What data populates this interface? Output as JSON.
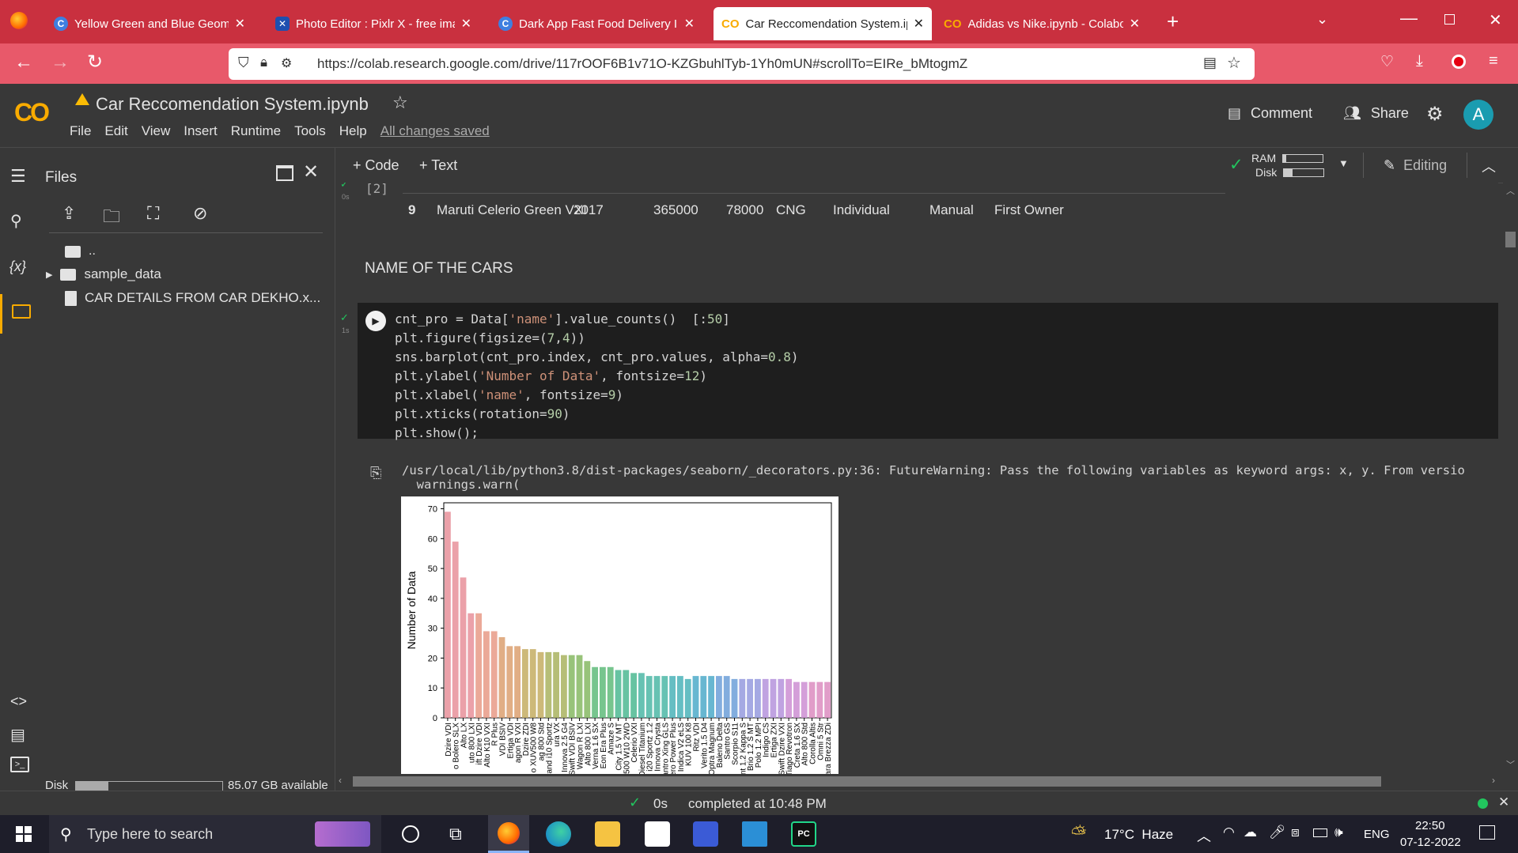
{
  "browser": {
    "tabs": [
      {
        "title": "Yellow Green and Blue Geometr",
        "active": false,
        "icon": "canva-icon"
      },
      {
        "title": "Photo Editor : Pixlr X - free imac",
        "active": false,
        "icon": "pixlr-icon"
      },
      {
        "title": "Dark App Fast Food Delivery Ins",
        "active": false,
        "icon": "canva-icon"
      },
      {
        "title": "Car Reccomendation System.ipy",
        "active": true,
        "icon": "colab-icon"
      },
      {
        "title": "Adidas vs Nike.ipynb - Colabora",
        "active": false,
        "icon": "colab-icon"
      }
    ],
    "url": "https://colab.research.google.com/drive/117rOOF6B1v71O-KZGbuhlTyb-1Yh0mUN#scrollTo=EIRe_bMtogmZ"
  },
  "colab": {
    "notebook_title": "Car Reccomendation System.ipynb",
    "menu": [
      "File",
      "Edit",
      "View",
      "Insert",
      "Runtime",
      "Tools",
      "Help"
    ],
    "saved_status": "All changes saved",
    "comment_label": "Comment",
    "share_label": "Share",
    "avatar_letter": "A",
    "toolbar": {
      "code_label": "+ Code",
      "text_label": "+ Text",
      "ram_label": "RAM",
      "disk_label": "Disk",
      "editing_label": "Editing"
    }
  },
  "files_panel": {
    "title": "Files",
    "items": [
      {
        "name": "..",
        "type": "up"
      },
      {
        "name": "sample_data",
        "type": "folder"
      },
      {
        "name": "CAR DETAILS FROM CAR DEKHO.x...",
        "type": "file"
      }
    ],
    "disk_label": "Disk",
    "disk_available": "85.07 GB available",
    "disk_usage_fraction": 0.22
  },
  "table_row": {
    "index": "9",
    "cells": [
      "Maruti Celerio Green VXI",
      "2017",
      "365000",
      "78000",
      "CNG",
      "Individual",
      "Manual",
      "First Owner"
    ]
  },
  "cells": {
    "prev_exec": "[2]",
    "prev_time": "0s",
    "heading": "NAME OF THE CARS",
    "exec_time": "1s",
    "output_warning": "/usr/local/lib/python3.8/dist-packages/seaborn/_decorators.py:36: FutureWarning: Pass the following variables as keyword args: x, y. From versio",
    "output_warning2": "  warnings.warn("
  },
  "chart_data": {
    "type": "bar",
    "ylabel": "Number of Data",
    "ylim": [
      0,
      72
    ],
    "yticks": [
      0,
      10,
      20,
      30,
      40,
      50,
      60,
      70
    ],
    "values": [
      69,
      59,
      47,
      35,
      35,
      29,
      29,
      27,
      24,
      24,
      23,
      23,
      22,
      22,
      22,
      21,
      21,
      21,
      19,
      17,
      17,
      17,
      16,
      16,
      15,
      15,
      14,
      14,
      14,
      14,
      14,
      13,
      14,
      14,
      14,
      14,
      14,
      13,
      13,
      13,
      13,
      13,
      13,
      13,
      13,
      12,
      12,
      12,
      12,
      12
    ],
    "categories": [
      "Dzire VDI",
      "o Bolero SLX",
      "Alto LX",
      "uto 800 LXI",
      "ift Dzire VDI",
      "Alto K10 VXI",
      "R Plus",
      "VDI BSIV",
      "Ertiga VDI",
      "agon R VXI",
      "Dzire ZDI",
      "o XUV500 W8",
      "ag 800 Std",
      "Grand i10 Sportz",
      "ura VX",
      "Innova 2.5 G4",
      "Swift VDI BSIV",
      "Wagon R LXI",
      "Alto 800 LXI",
      "Verna 1.6 SX",
      "Eon Era Plus",
      "Amaze S",
      "City 1.5 V MT",
      "XUV500 W10 2WD",
      "Celerio VXI",
      "EcoSport 1.5 Diesel Titanium",
      "i20 Sportz 1.2",
      "Innova Crysta",
      "Santro Xing GLS",
      "Bolero Power Plus",
      "Indica V2 eLS",
      "KUV 100 K8",
      "Ritz VDI",
      "Verito 1.5 D4",
      "Optra Magnum",
      "Baleno Delta",
      "Santro GS",
      "Scorpio S11",
      "Xcent 1.2 Kappa S",
      "Brio 1.2 S MT",
      "Polo 1.2 MPI",
      "Indigo CS",
      "Ertiga ZXI",
      "Swift Dzire VXI",
      "Tiago Revotron",
      "Creta 1.6 SX",
      "Alto 800 Std",
      "Corolla Altis",
      "Omni 5 Str",
      "Vitara Brezza ZDi"
    ]
  },
  "status": {
    "time": "0s",
    "completed": "completed at 10:48 PM"
  },
  "taskbar": {
    "search_placeholder": "Type here to search",
    "weather": "17°C  Haze",
    "lang": "ENG",
    "clock_time": "22:50",
    "clock_date": "07-12-2022"
  },
  "colors": {
    "browser_red": "#c9303f",
    "nav_red": "#e8596a",
    "colab_orange": "#f9ab00",
    "accent_green": "#22c55e"
  }
}
